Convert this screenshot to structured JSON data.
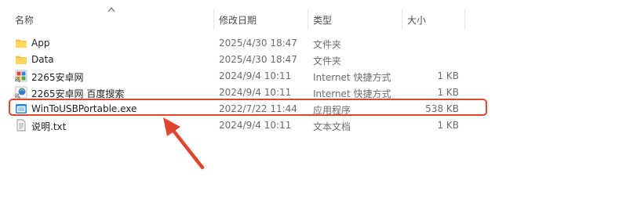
{
  "columns": {
    "name": "名称",
    "date": "修改日期",
    "type": "类型",
    "size": "大小"
  },
  "files": [
    {
      "name": "App",
      "date": "2025/4/30 18:47",
      "type": "文件夹",
      "size": "",
      "icon": "folder-icon"
    },
    {
      "name": "Data",
      "date": "2025/4/30 18:47",
      "type": "文件夹",
      "size": "",
      "icon": "folder-icon"
    },
    {
      "name": "2265安卓网",
      "date": "2024/9/4 10:11",
      "type": "Internet 快捷方式",
      "size": "1 KB",
      "icon": "internet-shortcut-icon"
    },
    {
      "name": "2265安卓网 百度搜索",
      "date": "2024/9/4 10:11",
      "type": "Internet 快捷方式",
      "size": "1 KB",
      "icon": "internet-shortcut-icon"
    },
    {
      "name": "WinToUSBPortable.exe",
      "date": "2022/7/22 11:44",
      "type": "应用程序",
      "size": "538 KB",
      "icon": "application-icon"
    },
    {
      "name": "说明.txt",
      "date": "2024/9/4 10:11",
      "type": "文本文档",
      "size": "1 KB",
      "icon": "text-file-icon"
    }
  ],
  "colors": {
    "highlight": "#e0452f",
    "folder": "#f5c342"
  }
}
